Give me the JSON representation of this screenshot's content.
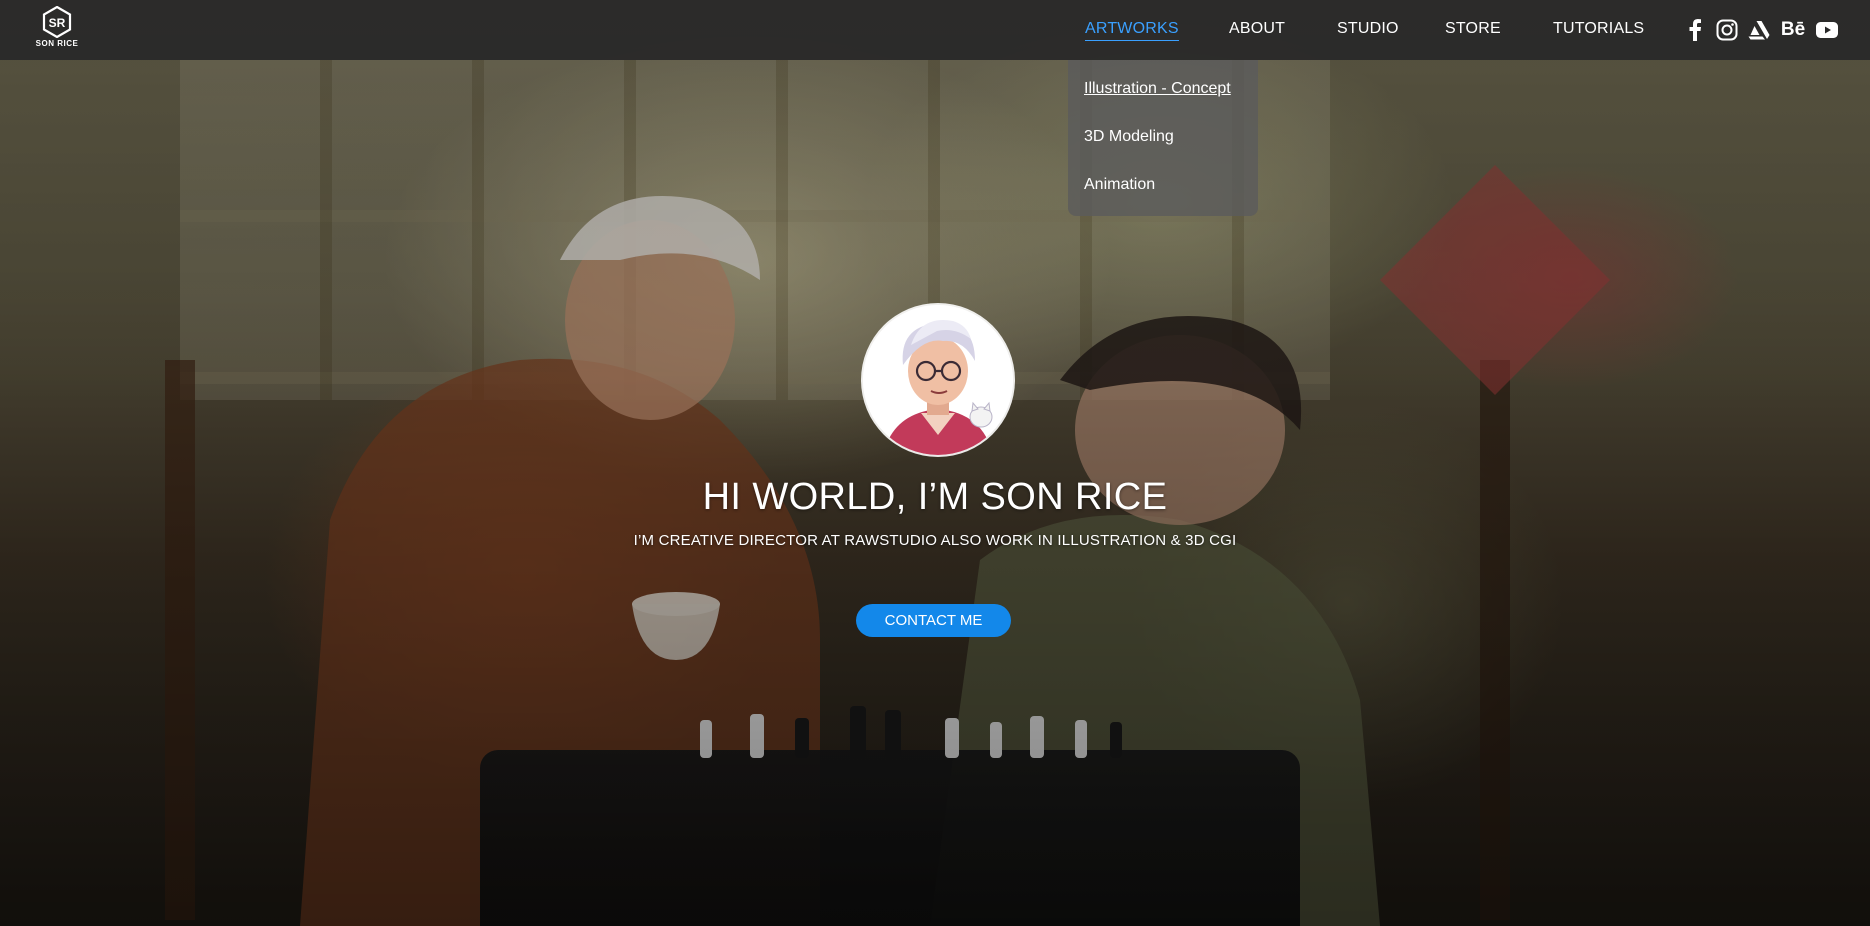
{
  "brand": {
    "name": "SON RICE",
    "logo_icon": "sr-monogram-logo"
  },
  "nav": {
    "items": [
      {
        "label": "ARTWORKS",
        "active": true
      },
      {
        "label": "ABOUT",
        "active": false
      },
      {
        "label": "STUDIO",
        "active": false
      },
      {
        "label": "STORE",
        "active": false
      },
      {
        "label": "TUTORIALS",
        "active": false
      }
    ],
    "dropdown": {
      "items": [
        {
          "label": "Illustration - Concept",
          "current": true
        },
        {
          "label": "3D Modeling",
          "current": false
        },
        {
          "label": "Animation",
          "current": false
        }
      ]
    }
  },
  "social": {
    "icons": [
      "facebook-icon",
      "instagram-icon",
      "artstation-icon",
      "behance-icon",
      "youtube-icon"
    ],
    "behance_label": "Bē"
  },
  "hero": {
    "headline": "HI WORLD, I’M SON RICE",
    "subline": "I’M CREATIVE DIRECTOR AT RAWSTUDIO ALSO WORK IN ILLUSTRATION & 3D CGI",
    "cta_label": "CONTACT ME"
  },
  "colors": {
    "accent": "#3aa0ff",
    "cta": "#1388ea",
    "topbar": "#282828",
    "dropdown": "#5c5c5c"
  }
}
